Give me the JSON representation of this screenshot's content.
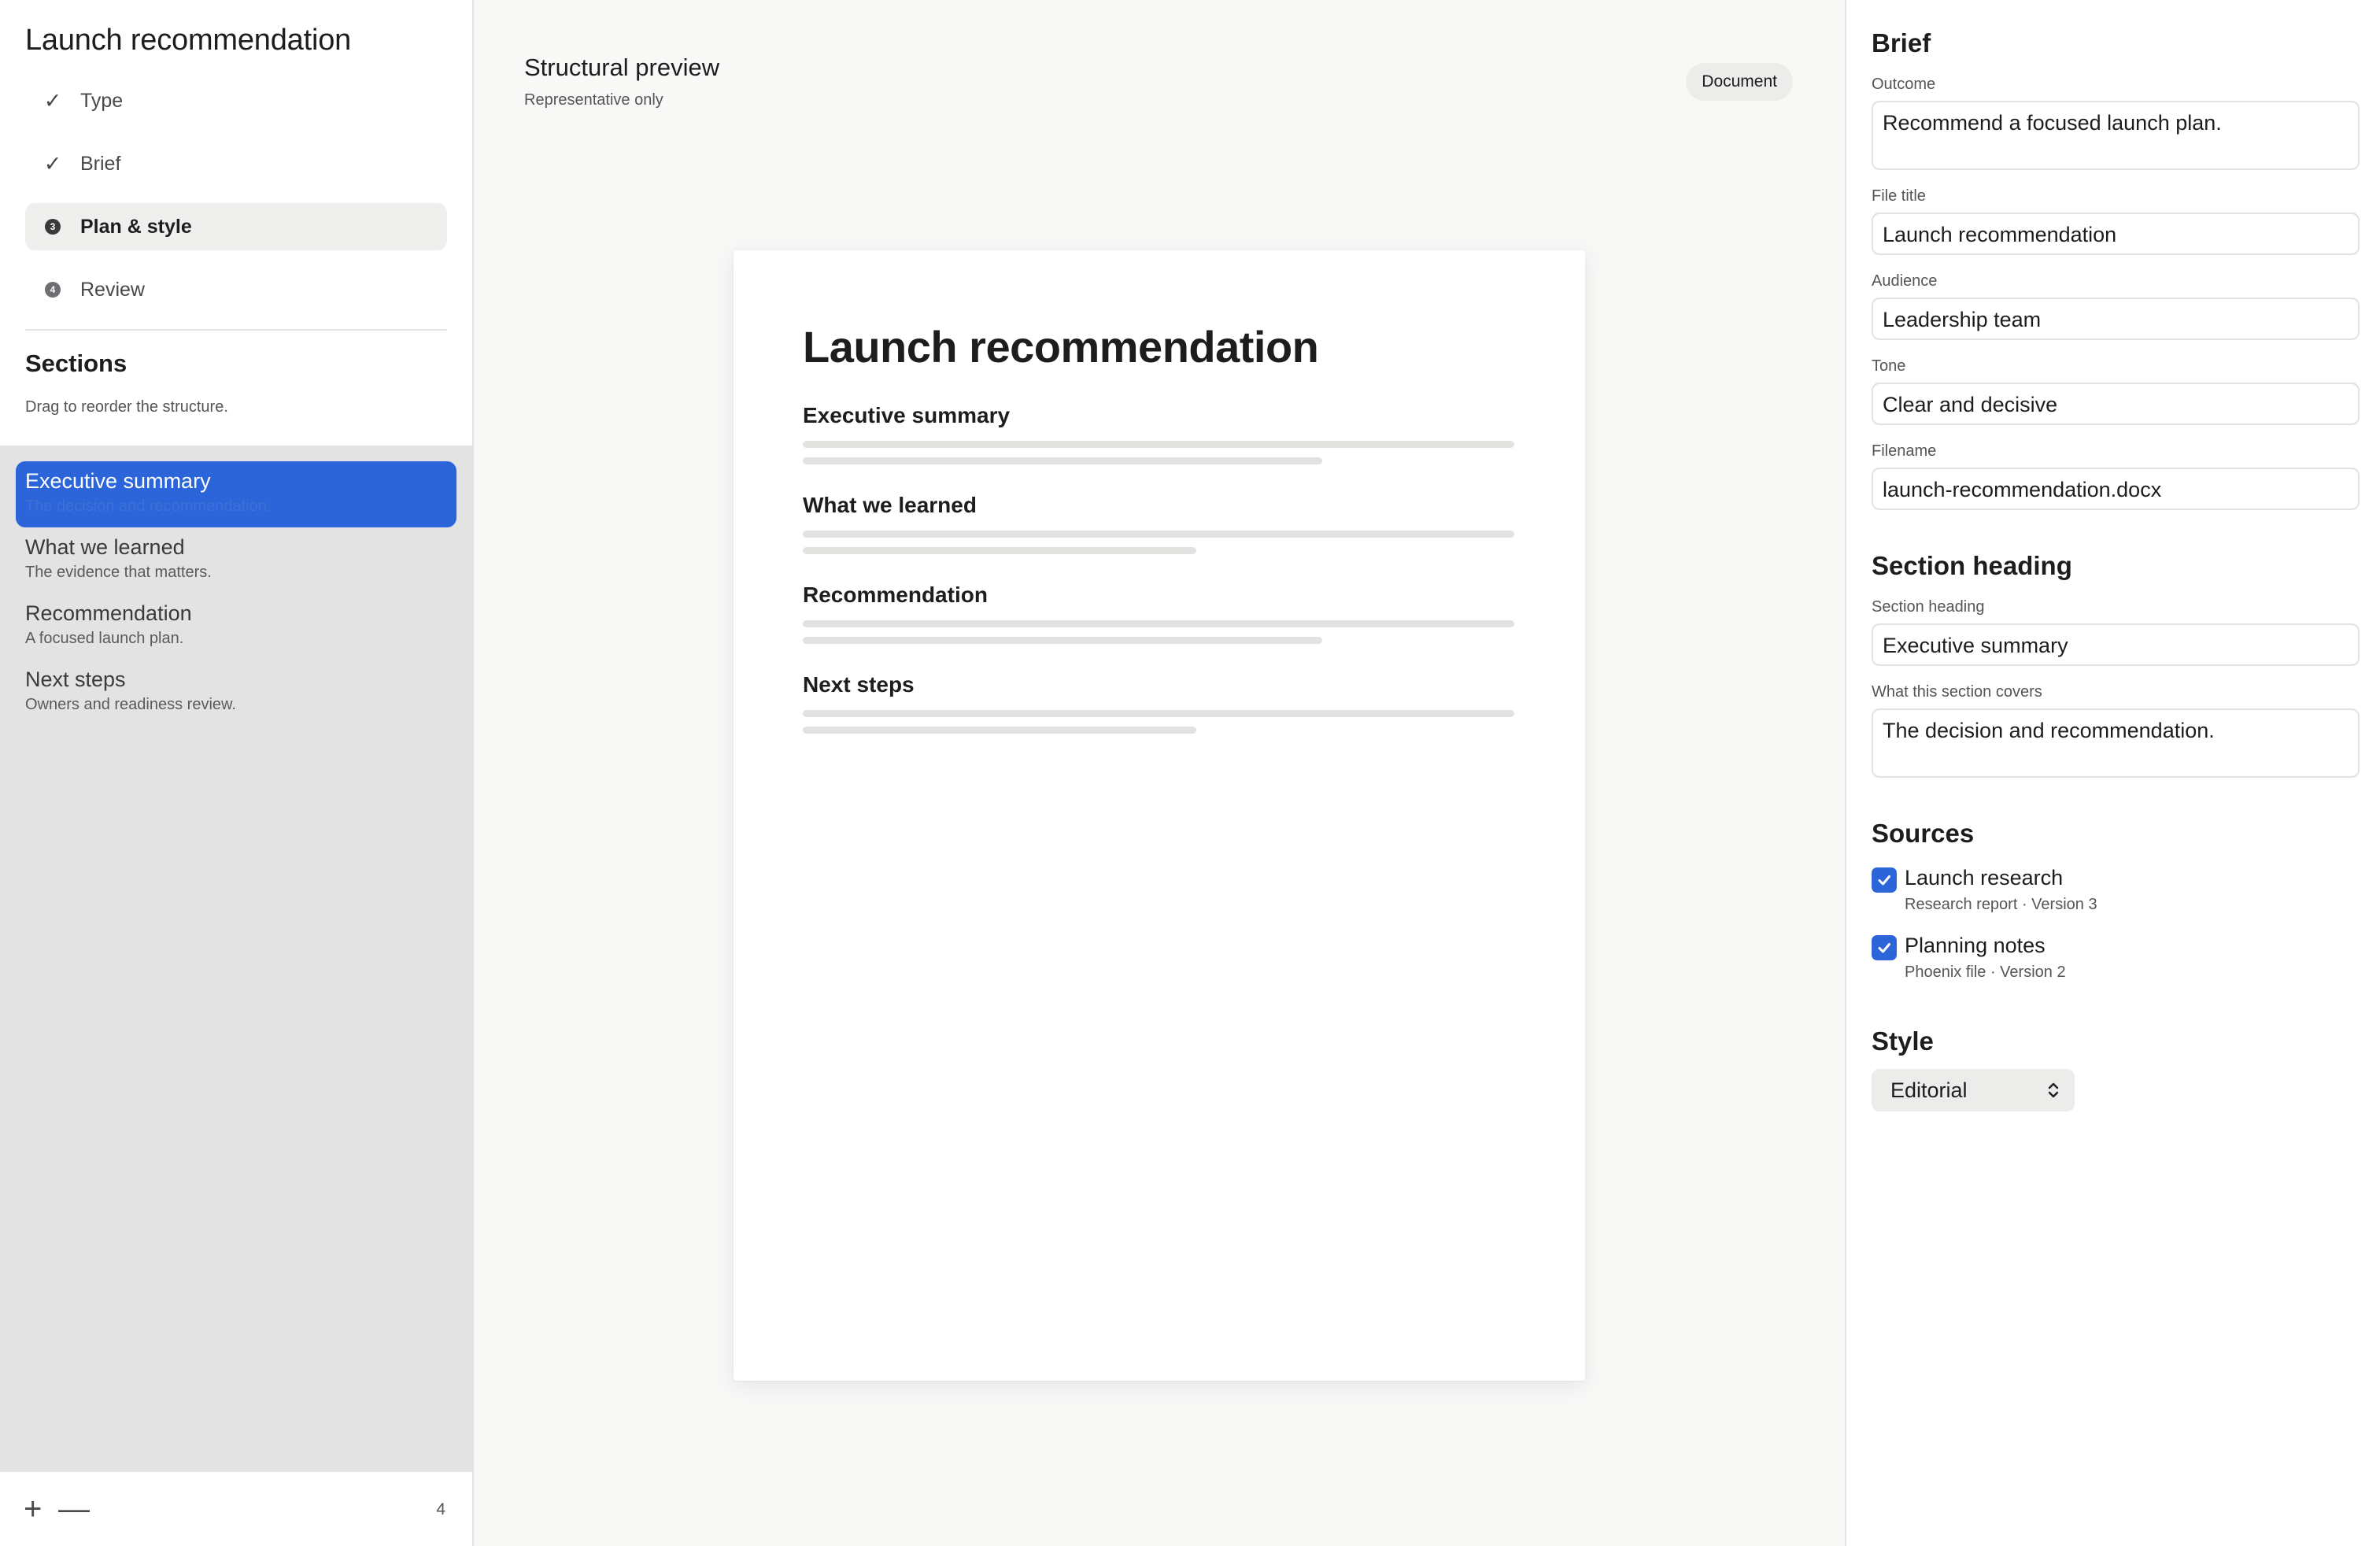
{
  "sidebar": {
    "title": "Launch recommendation",
    "steps": [
      {
        "label": "Type",
        "state": "done"
      },
      {
        "label": "Brief",
        "state": "done"
      },
      {
        "label": "Plan & style",
        "state": "current",
        "number": "3"
      },
      {
        "label": "Review",
        "state": "upcoming",
        "number": "4"
      }
    ],
    "check_glyph": "✓",
    "sections_title": "Sections",
    "sections_hint": "Drag to reorder the structure.",
    "sections": [
      {
        "name": "Executive summary",
        "desc": "The decision and recommendation."
      },
      {
        "name": "What we learned",
        "desc": "The evidence that matters."
      },
      {
        "name": "Recommendation",
        "desc": "A focused launch plan."
      },
      {
        "name": "Next steps",
        "desc": "Owners and readiness review."
      }
    ],
    "footer": {
      "add_glyph": "+",
      "remove_glyph": "—",
      "count": "4"
    }
  },
  "preview": {
    "title": "Structural preview",
    "subtitle": "Representative only",
    "badge": "Document",
    "page_title": "Launch recommendation",
    "sections": [
      {
        "heading": "Executive summary",
        "short_line": "long"
      },
      {
        "heading": "What we learned",
        "short_line": "medium"
      },
      {
        "heading": "Recommendation",
        "short_line": "long"
      },
      {
        "heading": "Next steps",
        "short_line": "medium"
      }
    ]
  },
  "inspector": {
    "brief_title": "Brief",
    "outcome_label": "Outcome",
    "outcome_value": "Recommend a focused launch plan.",
    "file_title_label": "File title",
    "file_title_value": "Launch recommendation",
    "audience_label": "Audience",
    "audience_value": "Leadership team",
    "tone_label": "Tone",
    "tone_value": "Clear and decisive",
    "filename_label": "Filename",
    "filename_value": "launch-recommendation.docx",
    "section_title": "Section heading",
    "section_heading_label": "Section heading",
    "section_heading_value": "Executive summary",
    "covers_label": "What this section covers",
    "covers_value": "The decision and recommendation.",
    "sources_title": "Sources",
    "sources": [
      {
        "name": "Launch research",
        "meta": "Research report · Version 3",
        "checked": true
      },
      {
        "name": "Planning notes",
        "meta": "Phoenix file · Version 2",
        "checked": true
      }
    ],
    "style_title": "Style",
    "style_value": "Editorial"
  },
  "colors": {
    "accent": "#2b65d9",
    "selected_desc": "#3f70d8"
  }
}
